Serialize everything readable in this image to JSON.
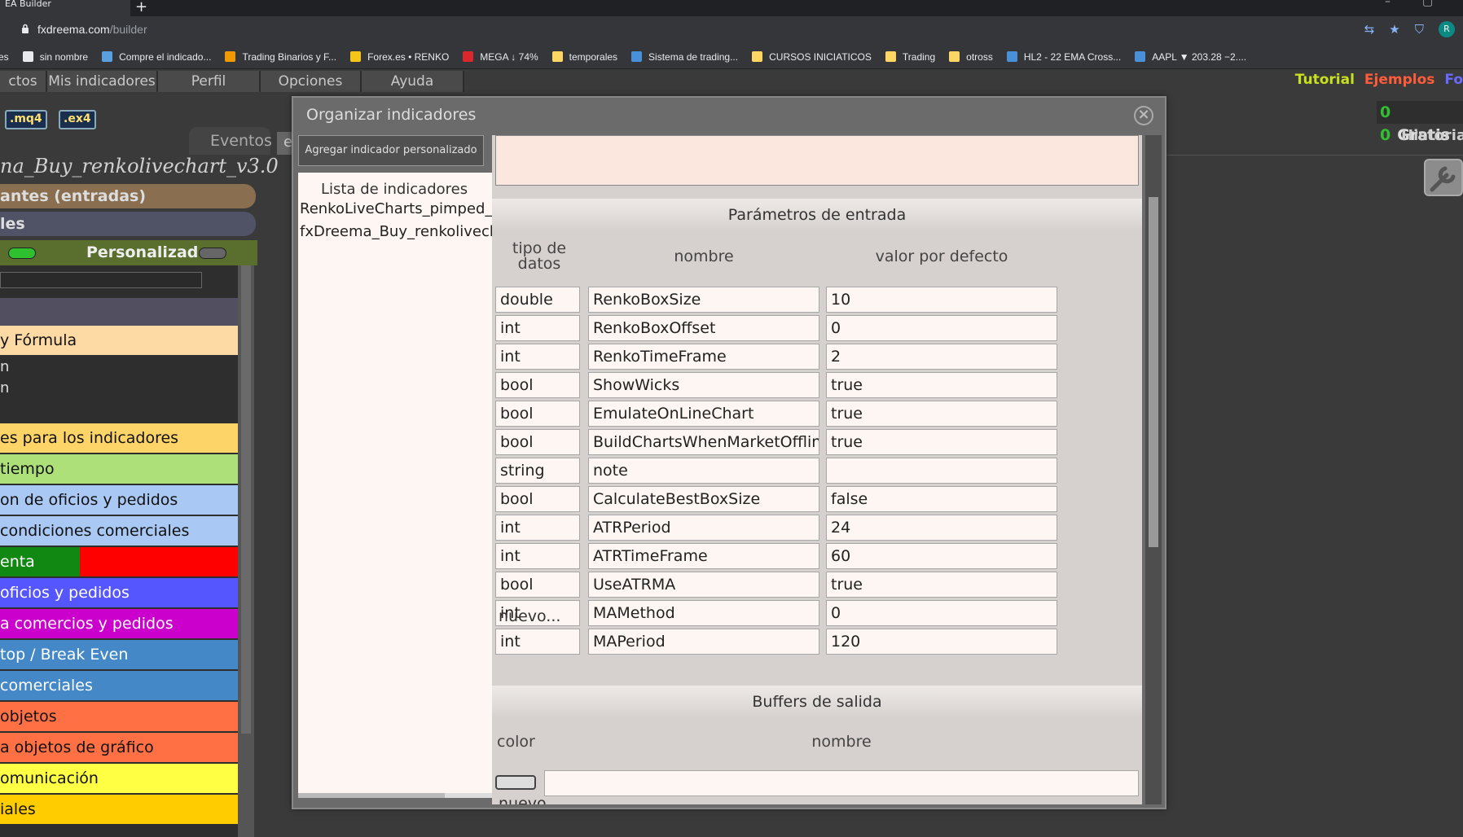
{
  "browser": {
    "tab_title": "EA Builder",
    "new_tab": "+",
    "url_host": "fxdreema.com",
    "url_path": "/builder",
    "profile_initial": "R",
    "bookmarks": [
      {
        "label": "es",
        "color": "#35363a"
      },
      {
        "label": "sin nombre",
        "color": "#e8eaed"
      },
      {
        "label": "Compre el indicado...",
        "color": "#5aa0e0"
      },
      {
        "label": "Trading Binarios y F...",
        "color": "#f29900"
      },
      {
        "label": "Forex.es • RENKO",
        "color": "#f5c518"
      },
      {
        "label": "MEGA ↓ 74%",
        "color": "#d9272e"
      },
      {
        "label": "temporales",
        "color": "#fdd663"
      },
      {
        "label": "Sistema de trading...",
        "color": "#4a90d9"
      },
      {
        "label": "CURSOS INICIATICOS",
        "color": "#fdd663"
      },
      {
        "label": "Trading",
        "color": "#fdd663"
      },
      {
        "label": "otross",
        "color": "#fdd663"
      },
      {
        "label": "HL2 - 22 EMA Cross...",
        "color": "#4a90d9"
      },
      {
        "label": "AAPL ▼ 203.28 −2....",
        "color": "#4a90d9"
      }
    ]
  },
  "appmenu": {
    "items": [
      "ctos",
      "Mis indicadores",
      "Perfil",
      "Opciones",
      "Ayuda"
    ],
    "tutorial": "Tutorial",
    "ejemplos": "Ejemplos",
    "fo": "Fo",
    "oo": "0 0",
    "gratis": "Gratis",
    "historia": "Historia"
  },
  "leftpane": {
    "mq4": ".mq4",
    "ex4": ".ex4",
    "eventos_tab": "Eventos",
    "eventos_tab2": "e",
    "project_name": "na_Buy_renkolivechart_v3.0",
    "pill1": "antes (entradas)",
    "pill2": "les",
    "personalizado": "Personalizado",
    "categories": [
      {
        "label": " y Fórmula",
        "color": "#fdd9a4",
        "white": false
      },
      {
        "label": "es para los indicadores",
        "color": "#fdd468",
        "white": false
      },
      {
        "label": "tiempo",
        "color": "#aee07a",
        "white": false
      },
      {
        "label": "on de oficios y pedidos",
        "color": "#a9c8f4",
        "white": false
      },
      {
        "label": " condiciones comerciales",
        "color": "#a9c8f4",
        "white": false
      },
      {
        "label": "enta",
        "color": "#ff0000",
        "white": true
      },
      {
        "label": "oficios y pedidos",
        "color": "#5656ff",
        "white": true
      },
      {
        "label": "a comercios y pedidos",
        "color": "#cc00cc",
        "white": true
      },
      {
        "label": "top / Break Even",
        "color": "#4488c8",
        "white": true
      },
      {
        "label": "comerciales",
        "color": "#4488c8",
        "white": true
      },
      {
        "label": "objetos",
        "color": "#ff7044",
        "white": false
      },
      {
        "label": "a objetos de gráfico",
        "color": "#ff7044",
        "white": false
      },
      {
        "label": "omunicación",
        "color": "#ffff44",
        "white": false
      },
      {
        "label": "iales",
        "color": "#ffcc00",
        "white": false
      }
    ],
    "sub1": "n",
    "sub2": "n"
  },
  "modal": {
    "title": "Organizar indicadores",
    "close": "×",
    "add_button": "Agregar indicador personalizado",
    "list_header": "Lista de indicadores",
    "list_items": [
      "RenkoLiveCharts_pimped_v",
      "fxDreema_Buy_renkolivech"
    ],
    "params_header": "Parámetros de entrada",
    "col_type": "tipo de datos",
    "col_name": "nombre",
    "col_default": "valor por defecto",
    "params": [
      {
        "type": "double",
        "name": "RenkoBoxSize",
        "default": "10"
      },
      {
        "type": "int",
        "name": "RenkoBoxOffset",
        "default": "0"
      },
      {
        "type": "int",
        "name": "RenkoTimeFrame",
        "default": "2"
      },
      {
        "type": "bool",
        "name": "ShowWicks",
        "default": "true"
      },
      {
        "type": "bool",
        "name": "EmulateOnLineChart",
        "default": "true"
      },
      {
        "type": "bool",
        "name": "BuildChartsWhenMarketOffline",
        "default": "true"
      },
      {
        "type": "string",
        "name": "note",
        "default": ""
      },
      {
        "type": "bool",
        "name": "CalculateBestBoxSize",
        "default": "false"
      },
      {
        "type": "int",
        "name": "ATRPeriod",
        "default": "24"
      },
      {
        "type": "int",
        "name": "ATRTimeFrame",
        "default": "60"
      },
      {
        "type": "bool",
        "name": "UseATRMA",
        "default": "true"
      },
      {
        "type": "int",
        "name": "MAMethod",
        "default": "0"
      },
      {
        "type": "int",
        "name": "MAPeriod",
        "default": "120"
      }
    ],
    "new_param": "nuevo...",
    "buffers_header": "Buffers de salida",
    "buf_col_color": "color",
    "buf_col_name": "nombre",
    "new_buffer": "nuevo..."
  }
}
